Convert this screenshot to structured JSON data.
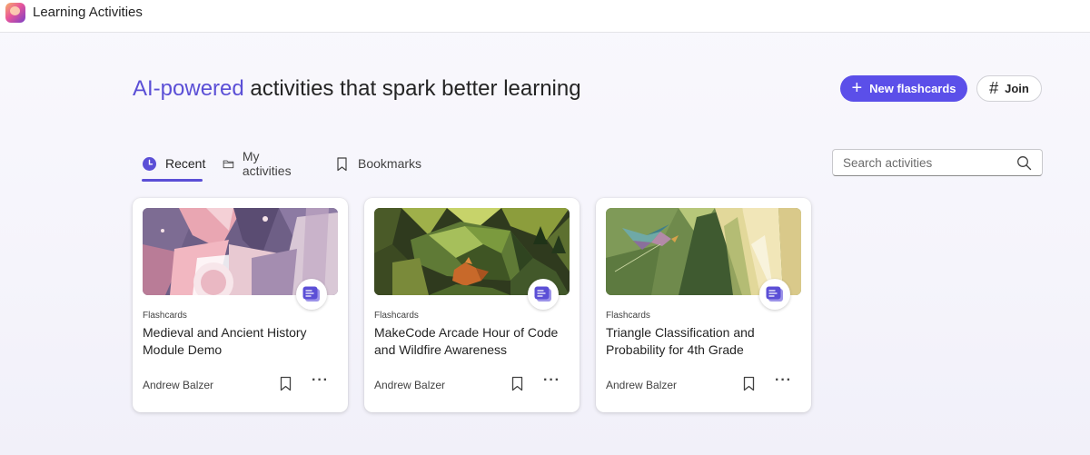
{
  "app": {
    "title": "Learning Activities"
  },
  "hero": {
    "headline_accent": "AI-powered",
    "headline_rest": " activities that spark better learning",
    "new_button": "New flashcards",
    "join_button": "Join"
  },
  "tabs": [
    {
      "label": "Recent",
      "icon": "clock-icon",
      "active": true
    },
    {
      "label": "My activities",
      "icon": "folder-icon",
      "active": false
    },
    {
      "label": "Bookmarks",
      "icon": "bookmark-icon",
      "active": false
    }
  ],
  "search": {
    "placeholder": "Search activities"
  },
  "cards": [
    {
      "type": "Flashcards",
      "title": "Medieval and Ancient History Module Demo",
      "author": "Andrew Balzer",
      "image": "abstract-geometric-pink-purple"
    },
    {
      "type": "Flashcards",
      "title": "MakeCode Arcade Hour of Code and Wildfire Awareness",
      "author": "Andrew Balzer",
      "image": "lowpoly-bear-and-fox-forest"
    },
    {
      "type": "Flashcards",
      "title": "Triangle Classification and Probability for 4th Grade",
      "author": "Andrew Balzer",
      "image": "lowpoly-bird-and-triangles"
    }
  ],
  "colors": {
    "accent": "#5b4fd6",
    "primary_button": "#5b4fe9",
    "badge_icon": "#5b4fd6"
  }
}
